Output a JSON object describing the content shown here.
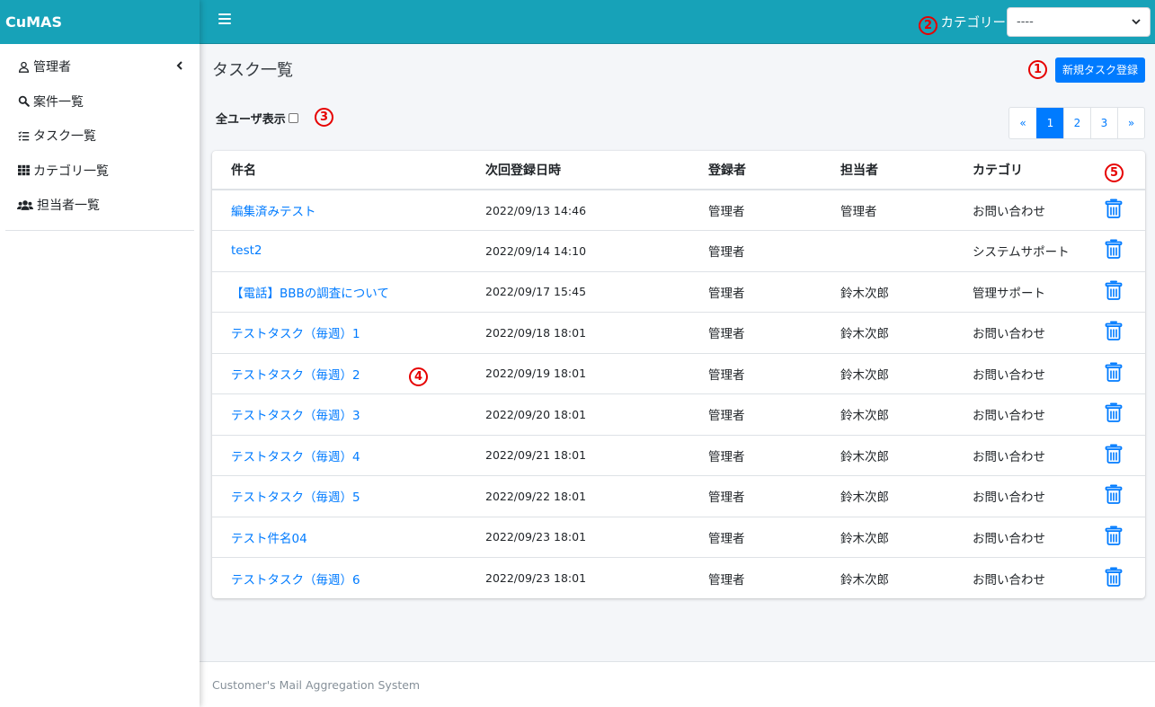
{
  "brand": "CuMAS",
  "sidebar": {
    "items": [
      {
        "label": "管理者",
        "icon": "user-icon",
        "has_caret": true
      },
      {
        "label": "案件一覧",
        "icon": "search-icon"
      },
      {
        "label": "タスク一覧",
        "icon": "tasks-icon"
      },
      {
        "label": "カテゴリ一覧",
        "icon": "grid-icon"
      },
      {
        "label": "担当者一覧",
        "icon": "users-icon"
      }
    ]
  },
  "topbar": {
    "category_label": "カテゴリー",
    "category_selected": "----"
  },
  "main": {
    "page_title": "タスク一覧",
    "new_task_button": "新規タスク登録",
    "all_users_label": "全ユーザ表示",
    "pagination": [
      "«",
      "1",
      "2",
      "3",
      "»"
    ],
    "pagination_active": "1"
  },
  "table": {
    "columns": [
      "件名",
      "次回登録日時",
      "登録者",
      "担当者",
      "カテゴリ"
    ],
    "rows": [
      {
        "title": "編集済みテスト",
        "date": "2022/09/13 14:46",
        "registrant": "管理者",
        "assignee": "管理者",
        "category": "お問い合わせ"
      },
      {
        "title": "test2",
        "date": "2022/09/14 14:10",
        "registrant": "管理者",
        "assignee": "",
        "category": "システムサポート"
      },
      {
        "title": "【電話】BBBの調査について",
        "date": "2022/09/17 15:45",
        "registrant": "管理者",
        "assignee": "鈴木次郎",
        "category": "管理サポート"
      },
      {
        "title": "テストタスク（毎週）1",
        "date": "2022/09/18 18:01",
        "registrant": "管理者",
        "assignee": "鈴木次郎",
        "category": "お問い合わせ"
      },
      {
        "title": "テストタスク（毎週）2",
        "date": "2022/09/19 18:01",
        "registrant": "管理者",
        "assignee": "鈴木次郎",
        "category": "お問い合わせ"
      },
      {
        "title": "テストタスク（毎週）3",
        "date": "2022/09/20 18:01",
        "registrant": "管理者",
        "assignee": "鈴木次郎",
        "category": "お問い合わせ"
      },
      {
        "title": "テストタスク（毎週）4",
        "date": "2022/09/21 18:01",
        "registrant": "管理者",
        "assignee": "鈴木次郎",
        "category": "お問い合わせ"
      },
      {
        "title": "テストタスク（毎週）5",
        "date": "2022/09/22 18:01",
        "registrant": "管理者",
        "assignee": "鈴木次郎",
        "category": "お問い合わせ"
      },
      {
        "title": "テスト件名04",
        "date": "2022/09/23 18:01",
        "registrant": "管理者",
        "assignee": "鈴木次郎",
        "category": "お問い合わせ"
      },
      {
        "title": "テストタスク（毎週）6",
        "date": "2022/09/23 18:01",
        "registrant": "管理者",
        "assignee": "鈴木次郎",
        "category": "お問い合わせ"
      }
    ]
  },
  "footer": "Customer's Mail Aggregation System",
  "markers": [
    "1",
    "2",
    "3",
    "4",
    "5"
  ],
  "colors": {
    "accent": "#17a2b8",
    "primary": "#007bff",
    "marker": "#e60000"
  }
}
